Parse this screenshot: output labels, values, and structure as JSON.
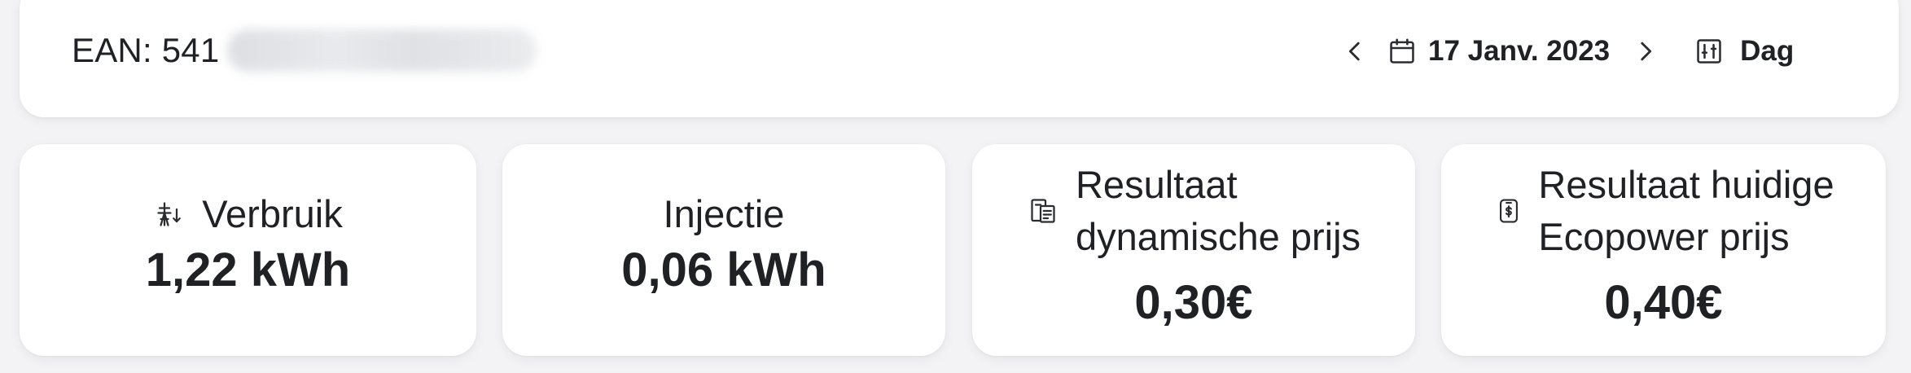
{
  "header": {
    "ean_label": "EAN: 541",
    "date": "17 Janv. 2023",
    "period": "Dag"
  },
  "stats": [
    {
      "label": "Verbruik",
      "value": "1,22 kWh",
      "icon": "power-tower-icon"
    },
    {
      "label": "Injectie",
      "value": "0,06 kWh"
    },
    {
      "label_line1": "Resultaat",
      "label_line2": "dynamische prijs",
      "value": "0,30€",
      "icon": "invoice-icon"
    },
    {
      "label_line1": "Resultaat huidige",
      "label_line2": "Ecopower prijs",
      "value": "0,40€",
      "icon": "dollar-phone-icon"
    }
  ],
  "colors": {
    "background": "#f3f3f5",
    "card": "#ffffff",
    "text": "#1f2125"
  }
}
